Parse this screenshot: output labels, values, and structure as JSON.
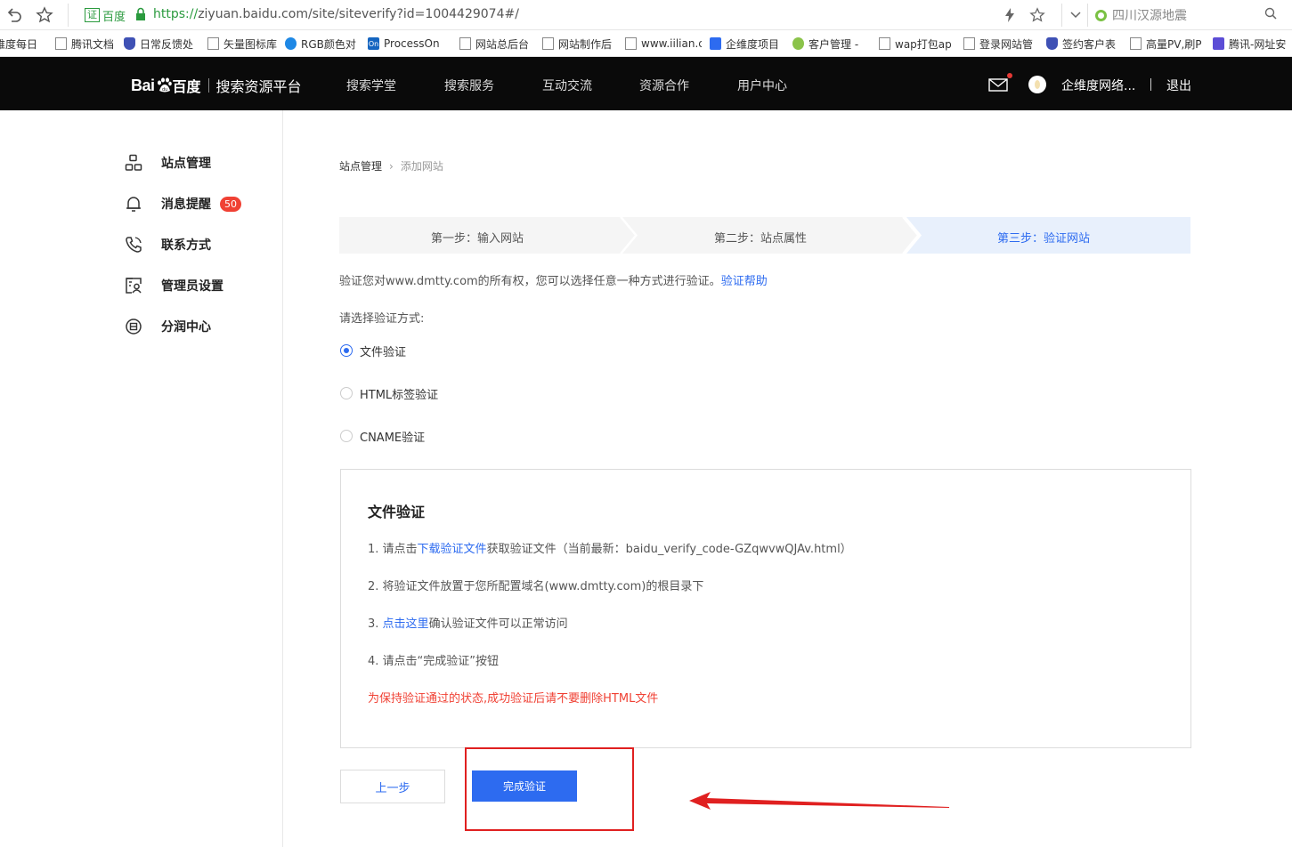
{
  "browser": {
    "url_cert_label": "百度",
    "url_scheme": "https://",
    "url_rest": "ziyuan.baidu.com/site/siteverify?id=1004429074#/",
    "search_text": "四川汉源地震"
  },
  "bookmarks": [
    {
      "label": "维度每日",
      "icon": "page"
    },
    {
      "label": "腾讯文档",
      "icon": "page"
    },
    {
      "label": "日常反馈处",
      "icon": "shield"
    },
    {
      "label": "矢量图标库",
      "icon": "page"
    },
    {
      "label": "RGB颜色对",
      "icon": "bluec"
    },
    {
      "label": "ProcessOn",
      "icon": "on"
    },
    {
      "label": "网站总后台",
      "icon": "page"
    },
    {
      "label": "网站制作后",
      "icon": "page"
    },
    {
      "label": "www.iilian.c",
      "icon": "page"
    },
    {
      "label": "企维度项目",
      "icon": "blue"
    },
    {
      "label": "客户管理 -",
      "icon": "green"
    },
    {
      "label": "wap打包ap",
      "icon": "page"
    },
    {
      "label": "登录网站管",
      "icon": "page"
    },
    {
      "label": "签约客户表",
      "icon": "shield"
    },
    {
      "label": "高量PV,刷P",
      "icon": "page"
    },
    {
      "label": "腾讯-网址安",
      "icon": "purple"
    }
  ],
  "header": {
    "logo_bai": "Bai",
    "logo_baidu": "百度",
    "platform_title": "搜索资源平台",
    "nav": [
      "搜索学堂",
      "搜索服务",
      "互动交流",
      "资源合作",
      "用户中心"
    ],
    "username": "企维度网络...",
    "logout": "退出"
  },
  "sidebar": {
    "items": [
      {
        "label": "站点管理",
        "icon": "site-manage-icon"
      },
      {
        "label": "消息提醒",
        "icon": "bell-icon",
        "badge": "50"
      },
      {
        "label": "联系方式",
        "icon": "phone-icon"
      },
      {
        "label": "管理员设置",
        "icon": "admin-settings-icon"
      },
      {
        "label": "分润中心",
        "icon": "revenue-share-icon"
      }
    ]
  },
  "main": {
    "breadcrumb": [
      "站点管理",
      "添加网站"
    ],
    "steps": [
      "第一步：输入网站",
      "第二步：站点属性",
      "第三步：验证网站"
    ],
    "active_step": 3,
    "description": "验证您对www.dmtty.com的所有权，您可以选择任意一种方式进行验证。",
    "help_link": "验证帮助",
    "choose_label": "请选择验证方式:",
    "methods": [
      {
        "label": "文件验证",
        "checked": true
      },
      {
        "label": "HTML标签验证",
        "checked": false
      },
      {
        "label": "CNAME验证",
        "checked": false
      }
    ],
    "panel": {
      "title": "文件验证",
      "line1_prefix": "1.  请点击",
      "line1_link": "下载验证文件",
      "line1_suffix": "获取验证文件（当前最新：baidu_verify_code-GZqwvwQJAv.html）",
      "line2": "2.  将验证文件放置于您所配置域名(www.dmtty.com)的根目录下",
      "line3_prefix": "3.  ",
      "line3_link": "点击这里",
      "line3_suffix": "确认验证文件可以正常访问",
      "line4": "4.  请点击“完成验证”按钮",
      "warning": "为保持验证通过的状态,成功验证后请不要删除HTML文件"
    },
    "prev_button": "上一步",
    "done_button": "完成验证"
  },
  "colors": {
    "accent": "#2d6bf0",
    "header_bg": "#0a0a0a",
    "warning": "#f04134",
    "annotation": "#e02020"
  }
}
